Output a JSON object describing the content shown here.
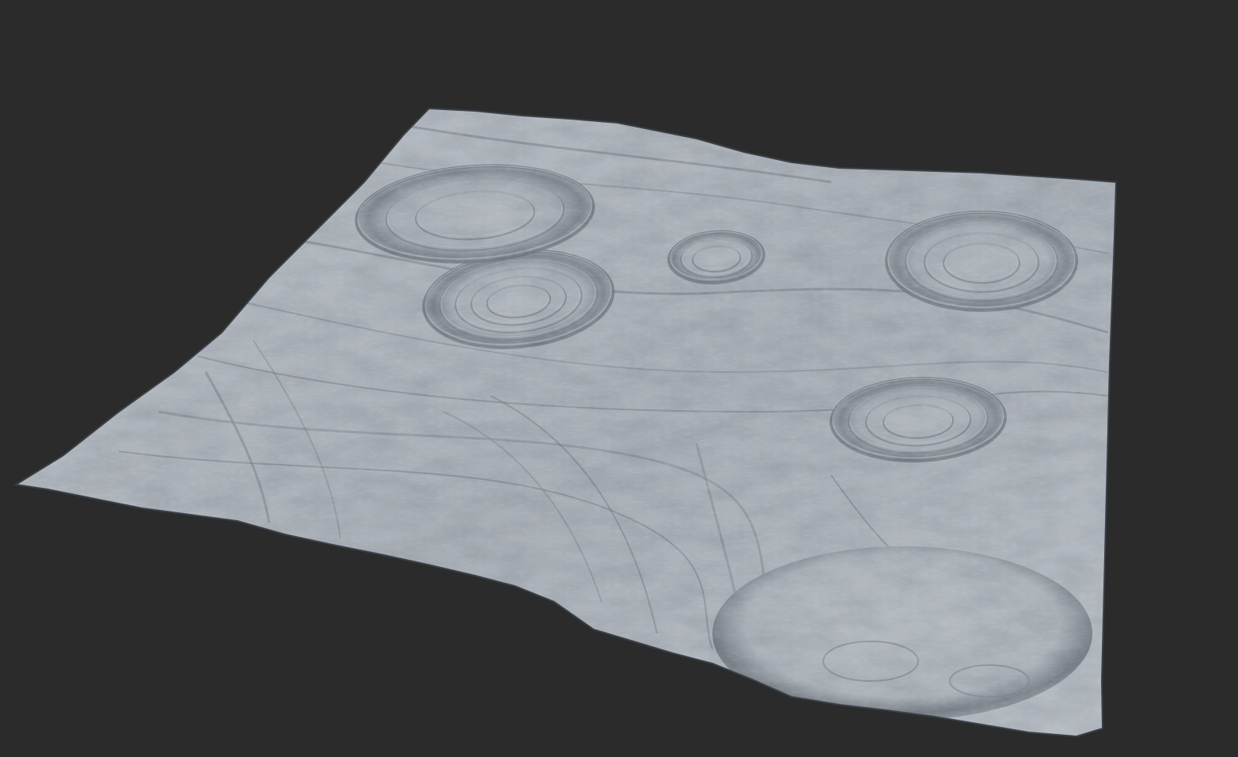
{
  "scene": {
    "background_color": "#2b2b2b",
    "surface_color": "#a9afb6",
    "surface_light": "#c9ced4",
    "surface_shadow": "#4a5159",
    "surface_deep_shadow": "#2f353c",
    "features": [
      "impact-crater",
      "impact-crater",
      "impact-crater",
      "impact-crater",
      "impact-crater",
      "basin",
      "ridges",
      "eroded-slopes"
    ]
  }
}
